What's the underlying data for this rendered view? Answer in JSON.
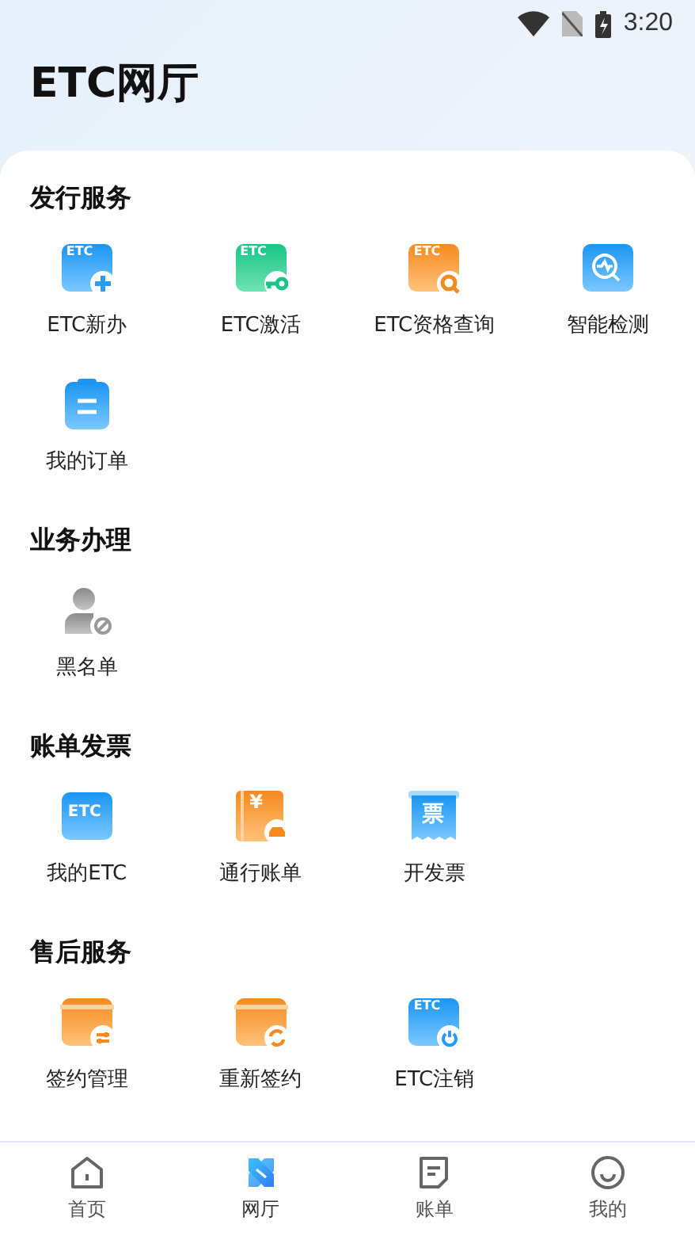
{
  "status_bar": {
    "time": "3:20"
  },
  "title": "ETC网厅",
  "sections": [
    {
      "title": "发行服务",
      "items": [
        {
          "label": "ETC新办",
          "kind": "etc-plus",
          "icon_text": "ETC"
        },
        {
          "label": "ETC激活",
          "kind": "etc-key",
          "icon_text": "ETC"
        },
        {
          "label": "ETC资格查询",
          "kind": "etc-search",
          "icon_text": "ETC"
        },
        {
          "label": "智能检测",
          "kind": "detect"
        },
        {
          "label": "我的订单",
          "kind": "clipboard"
        }
      ]
    },
    {
      "title": "业务办理",
      "items": [
        {
          "label": "黑名单",
          "kind": "user-block"
        }
      ]
    },
    {
      "title": "账单发票",
      "items": [
        {
          "label": "我的ETC",
          "kind": "etc-card",
          "icon_text": "ETC"
        },
        {
          "label": "通行账单",
          "kind": "bill-book",
          "icon_text": "¥"
        },
        {
          "label": "开发票",
          "kind": "invoice",
          "icon_text": "票"
        }
      ]
    },
    {
      "title": "售后服务",
      "items": [
        {
          "label": "签约管理",
          "kind": "card-adjust"
        },
        {
          "label": "重新签约",
          "kind": "card-refresh"
        },
        {
          "label": "ETC注销",
          "kind": "etc-power",
          "icon_text": "ETC"
        }
      ]
    }
  ],
  "nav": [
    {
      "label": "首页",
      "kind": "home",
      "selected": false
    },
    {
      "label": "网厅",
      "kind": "hall",
      "selected": true
    },
    {
      "label": "账单",
      "kind": "bill",
      "selected": false
    },
    {
      "label": "我的",
      "kind": "smile",
      "selected": false
    }
  ]
}
